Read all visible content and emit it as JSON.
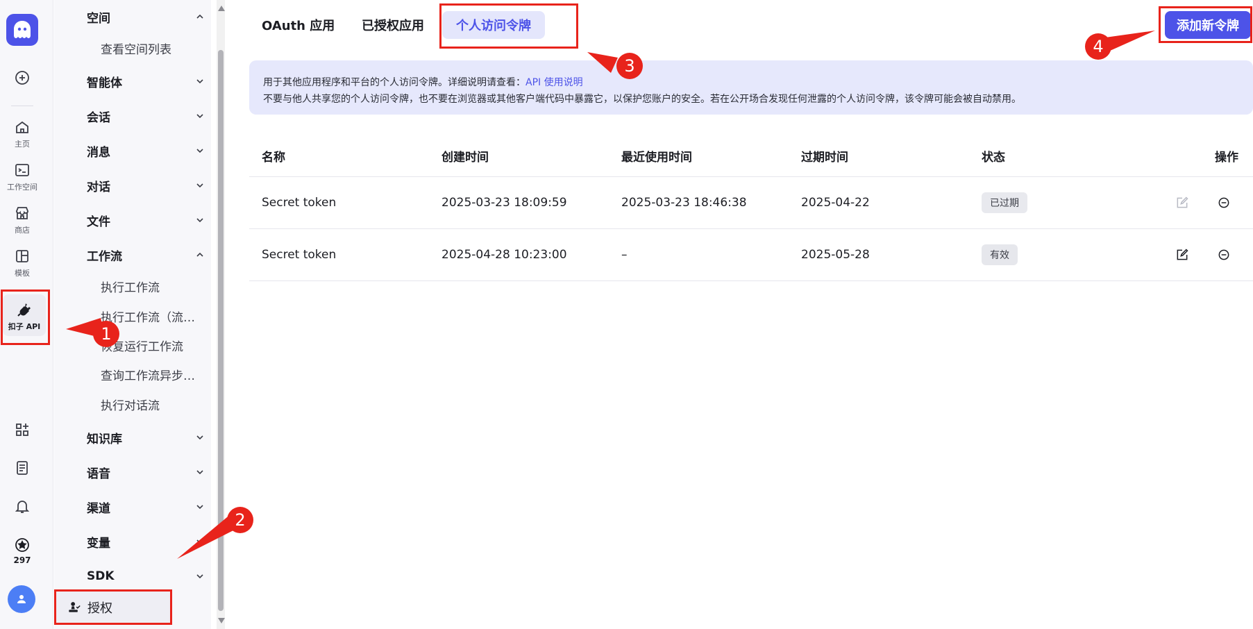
{
  "rail": {
    "items": [
      {
        "icon": "plus-circle-icon",
        "label": ""
      },
      {
        "icon": "home-icon",
        "label": "主页"
      },
      {
        "icon": "terminal-icon",
        "label": "工作空间"
      },
      {
        "icon": "store-icon",
        "label": "商店"
      },
      {
        "icon": "layout-icon",
        "label": "模板"
      },
      {
        "icon": "plug-icon",
        "label": "扣子 API"
      }
    ],
    "bottom": {
      "apps_icon": "apps-icon",
      "doc_icon": "document-icon",
      "bell_icon": "bell-icon",
      "credit_icon": "credit-icon",
      "credit_value": "297",
      "avatar_icon": "user-avatar-icon"
    }
  },
  "nav": {
    "space": "空间",
    "space_list": "查看空间列表",
    "agent": "智能体",
    "conversation": "会话",
    "message": "消息",
    "chat": "对话",
    "file": "文件",
    "workflow": "工作流",
    "workflow_items": [
      "执行工作流",
      "执行工作流（流式响应）",
      "恢复运行工作流",
      "查询工作流异步执行结果",
      "执行对话流"
    ],
    "knowledge": "知识库",
    "voice": "语音",
    "channel": "渠道",
    "variable": "变量",
    "sdk": "SDK",
    "auth": "授权"
  },
  "tabs": [
    "OAuth 应用",
    "已授权应用",
    "个人访问令牌"
  ],
  "active_tab": "个人访问令牌",
  "add_button": "添加新令牌",
  "info": {
    "line1_prefix": "用于其他应用程序和平台的个人访问令牌。详细说明请查看：",
    "line1_link": "API 使用说明",
    "line2": "不要与他人共享您的个人访问令牌，也不要在浏览器或其他客户端代码中暴露它，以保护您账户的安全。若在公开场合发现任何泄露的个人访问令牌，该令牌可能会被自动禁用。"
  },
  "table": {
    "headers": [
      "名称",
      "创建时间",
      "最近使用时间",
      "过期时间",
      "状态",
      "操作"
    ],
    "rows": [
      {
        "name": "Secret token",
        "created": "2025-03-23 18:09:59",
        "last_used": "2025-03-23 18:46:38",
        "expires": "2025-04-22",
        "status": "已过期"
      },
      {
        "name": "Secret token",
        "created": "2025-04-28 10:23:00",
        "last_used": "–",
        "expires": "2025-05-28",
        "status": "有效"
      }
    ]
  },
  "annotations": [
    "1",
    "2",
    "3",
    "4"
  ],
  "colors": {
    "accent": "#4d53e8",
    "annotation": "#e8231b",
    "info_bg": "#e6e8fc"
  }
}
